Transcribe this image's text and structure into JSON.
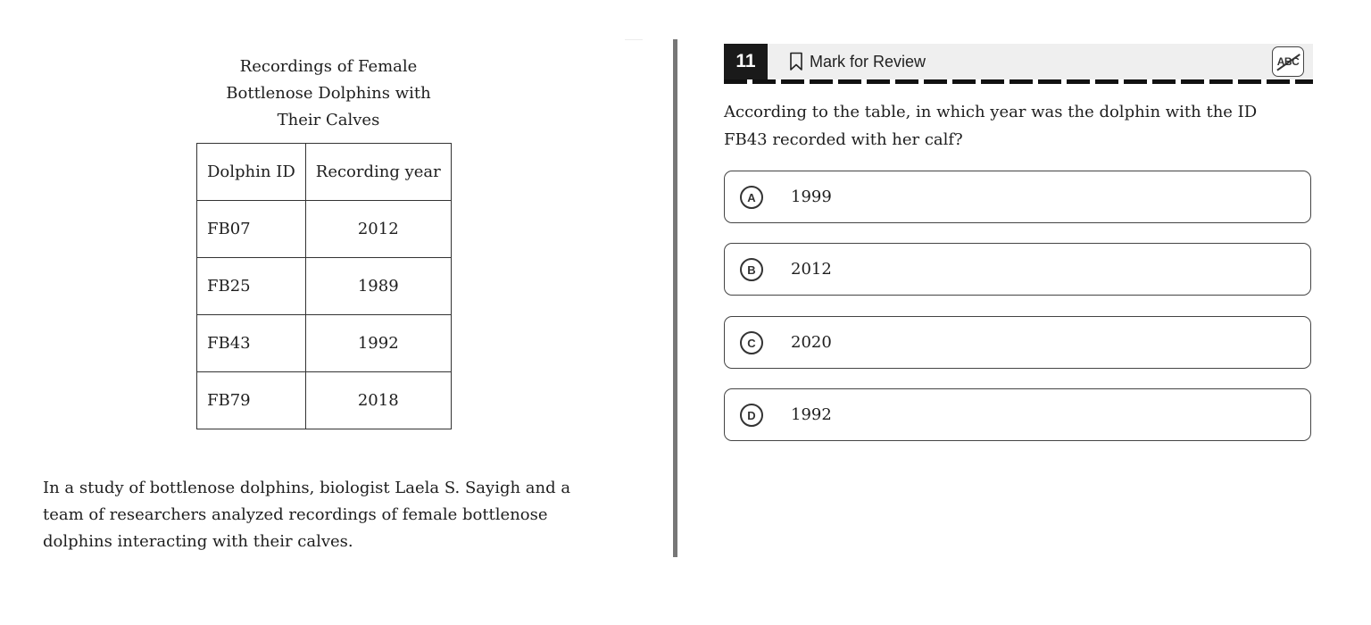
{
  "passage": {
    "table_title": [
      "Recordings of Female",
      "Bottlenose Dolphins with",
      "Their Calves"
    ],
    "table": {
      "headers": [
        "Dolphin ID",
        "Recording year"
      ],
      "rows": [
        [
          "FB07",
          "2012"
        ],
        [
          "FB25",
          "1989"
        ],
        [
          "FB43",
          "1992"
        ],
        [
          "FB79",
          "2018"
        ]
      ]
    },
    "text": "In a study of bottlenose dolphins, biologist Laela S. Sayigh and a team of researchers analyzed recordings of female bottlenose dolphins interacting with their calves."
  },
  "question": {
    "number": "11",
    "mark_for_review_label": "Mark for Review",
    "abc_label": "ABC",
    "prompt": "According to the table, in which year was the dolphin with the ID FB43 recorded with her calf?",
    "choices": [
      {
        "letter": "A",
        "text": "1999"
      },
      {
        "letter": "B",
        "text": "2012"
      },
      {
        "letter": "C",
        "text": "2020"
      },
      {
        "letter": "D",
        "text": "1992"
      }
    ]
  },
  "icons": {
    "bookmark": "bookmark-icon",
    "abc": "strikethrough-abc-icon"
  }
}
